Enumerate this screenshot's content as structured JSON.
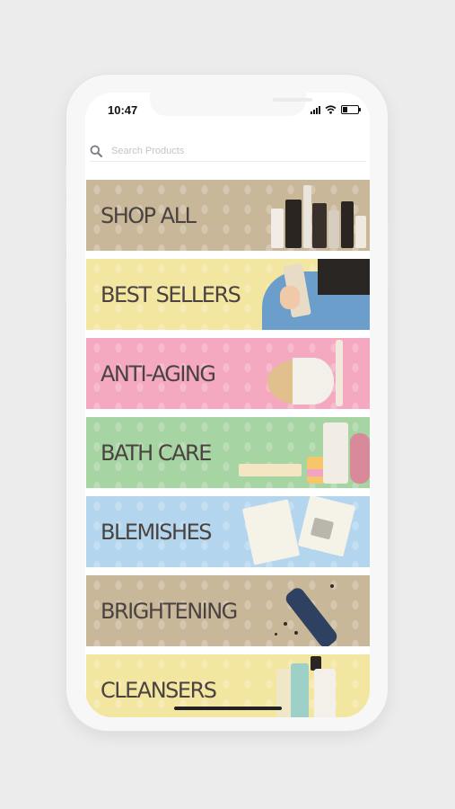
{
  "status_bar": {
    "time": "10:47"
  },
  "search": {
    "placeholder": "Search Products",
    "icon": "search-icon"
  },
  "categories": [
    {
      "label": "SHOP ALL",
      "color": "#c9b79a"
    },
    {
      "label": "BEST SELLERS",
      "color": "#f3e6a0"
    },
    {
      "label": "ANTI-AGING",
      "color": "#f4a9c0"
    },
    {
      "label": "BATH CARE",
      "color": "#a6d4a3"
    },
    {
      "label": "BLEMISHES",
      "color": "#b3d5ee"
    },
    {
      "label": "BRIGHTENING",
      "color": "#c9b79a"
    },
    {
      "label": "CLEANSERS",
      "color": "#f3e6a0"
    }
  ]
}
